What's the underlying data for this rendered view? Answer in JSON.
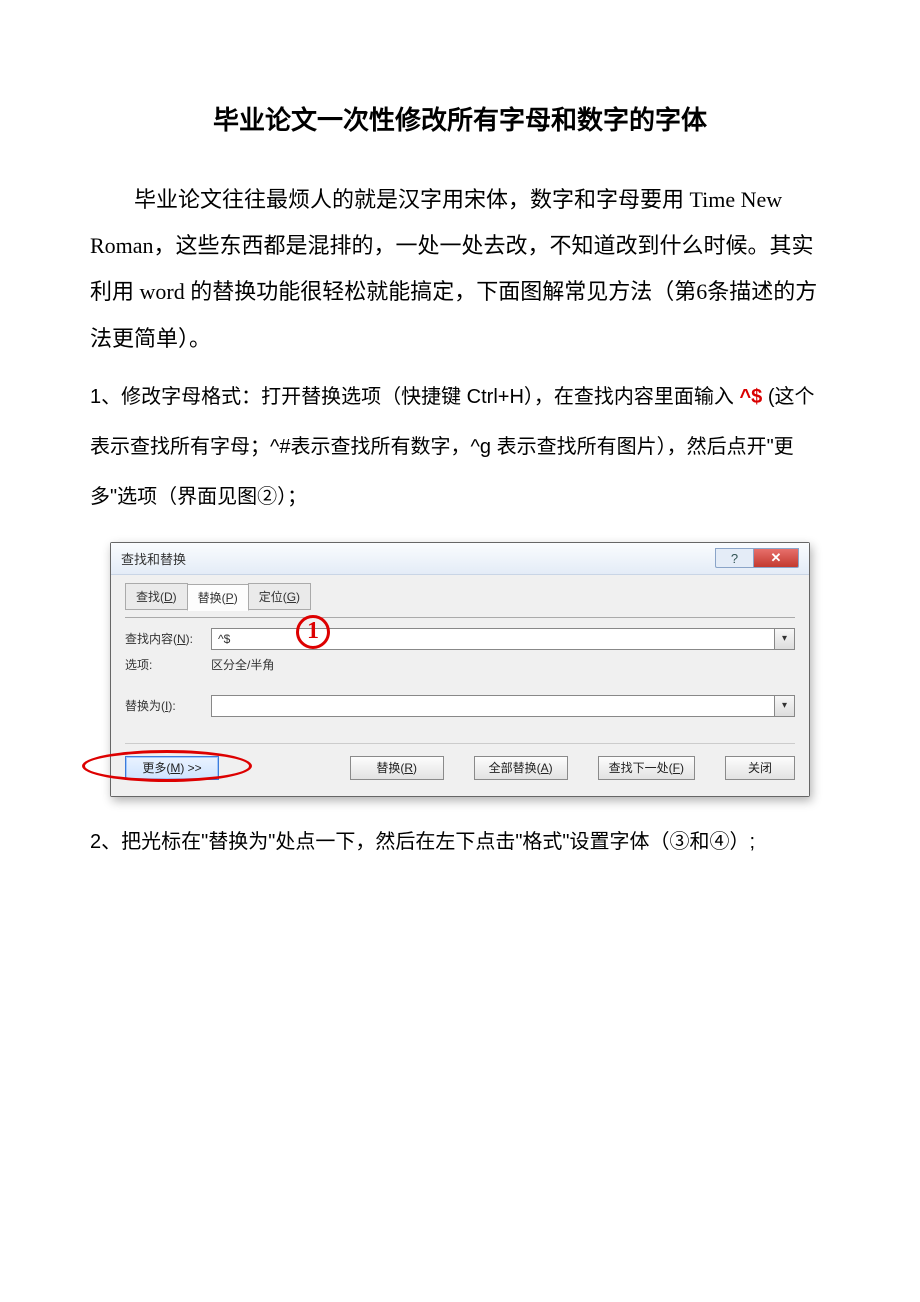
{
  "doc": {
    "title": "毕业论文一次性修改所有字母和数字的字体",
    "intro": "毕业论文往往最烦人的就是汉字用宋体，数字和字母要用 Time New Roman，这些东西都是混排的，一处一处去改，不知道改到什么时候。其实利用 word 的替换功能很轻松就能搞定，下面图解常见方法（第6条描述的方法更简单）。",
    "step1_pre": "1、修改字母格式：打开替换选项（快捷键 Ctrl+H），在查找内容里面输入",
    "step1_code": "^$",
    "step1_post": "(这个表示查找所有字母；^#表示查找所有数字，^g 表示查找所有图片），然后点开\"更多\"选项（界面见图②）；",
    "step2": "2、把光标在\"替换为\"处点一下，然后在左下点击\"格式\"设置字体（③和④）;"
  },
  "dialog": {
    "title": "查找和替换",
    "help": "?",
    "close": "✕",
    "tabs": {
      "find": "查找(D)",
      "replace": "替换(P)",
      "goto": "定位(G)"
    },
    "find_label": "查找内容(N):",
    "find_value": "^$",
    "options_label": "选项:",
    "options_value": "区分全/半角",
    "replace_label": "替换为(I):",
    "replace_value": "",
    "buttons": {
      "more": "更多(M) >>",
      "replace": "替换(R)",
      "replace_all": "全部替换(A)",
      "find_next": "查找下一处(F)",
      "close": "关闭"
    },
    "anno1": "1"
  }
}
